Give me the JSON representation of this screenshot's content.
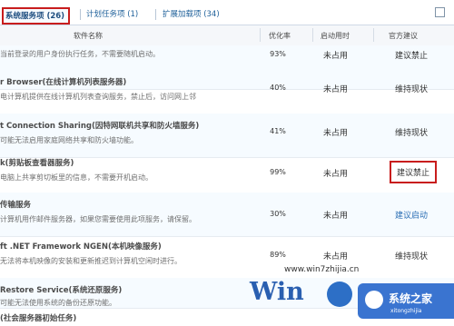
{
  "tabs": [
    {
      "label": "系统服务项 (26)"
    },
    {
      "label": "计划任务项 (1)"
    },
    {
      "label": "扩展加载项 (34)"
    }
  ],
  "header": {
    "name": "软件名称",
    "rate": "优化率",
    "status": "启动用时",
    "advice": "官方建议"
  },
  "rows": [
    {
      "name": "",
      "desc": "当前登录的用户身份执行任务，不需要随机启动。",
      "rate": "93%",
      "status": "未占用",
      "advice": "建议禁止"
    },
    {
      "name": "r Browser(在线计算机列表服务器)",
      "desc": "电计算机提供在线计算机列表查询服务，禁止后，访问网上邻",
      "rate": "40%",
      "status": "未占用",
      "advice": "维持现状"
    },
    {
      "name": "t Connection Sharing(因特网联机共享和防火墙服务)",
      "desc": "可能无法启用家庭网络共享和防火墙功能。",
      "rate": "41%",
      "status": "未占用",
      "advice": "维持现状"
    },
    {
      "name": "k(剪贴板查看器服务)",
      "desc": "电脑上共享剪切板里的信息，不需要开机启动。",
      "rate": "99%",
      "status": "未占用",
      "advice": "建议禁止"
    },
    {
      "name": "传输服务",
      "desc": "计算机用作邮件服务器，如果您需要使用此项服务，请保留。",
      "rate": "30%",
      "status": "未占用",
      "advice": "建议启动"
    },
    {
      "name": "ft .NET Framework NGEN(本机映像服务)",
      "desc": "无法将本机映像的安装和更新推迟到计算机空闲时进行。",
      "rate": "89%",
      "status": "未占用",
      "advice": "维持现状"
    },
    {
      "name": "Restore Service(系统还原服务)",
      "desc": "可能无法使用系统的备份还原功能。",
      "rate": "",
      "status": "",
      "advice": ""
    },
    {
      "name": "(社会服务器初始任务)",
      "desc": "",
      "rate": "",
      "status": "",
      "advice": ""
    }
  ],
  "watermark": {
    "site": "www.win7zhijia.cn",
    "logo": "Win",
    "brand": "系统之家",
    "brand_small": "xitongzhijia"
  }
}
